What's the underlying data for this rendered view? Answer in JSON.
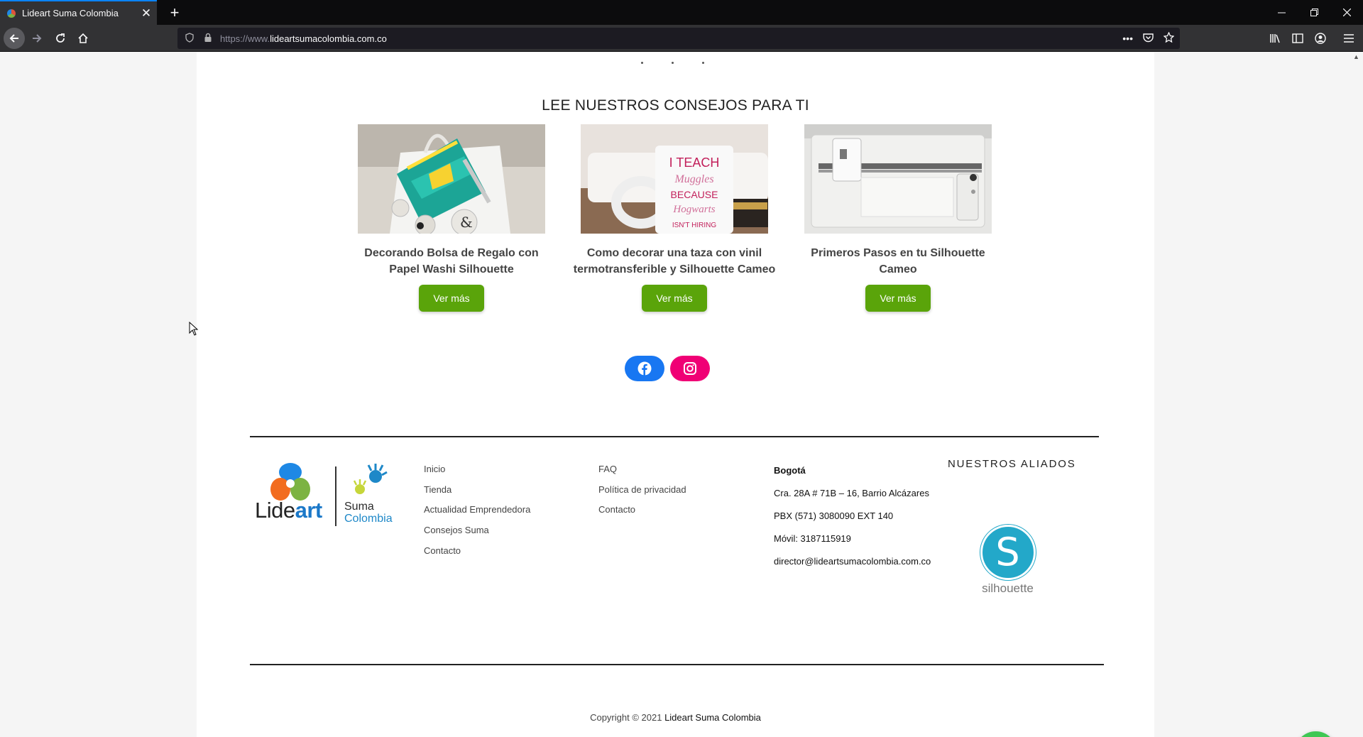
{
  "browser": {
    "tab_title": "Lideart Suma Colombia",
    "url_prefix": "https://www.",
    "url_domain": "lideartsumacolombia.com.co",
    "new_tab": "+",
    "tab_close": "✕"
  },
  "page": {
    "section_title": "LEE NUESTROS CONSEJOS PARA TI",
    "cards": [
      {
        "title": "Decorando Bolsa de Regalo con Papel Washi Silhouette",
        "button": "Ver más"
      },
      {
        "title": "Como decorar una taza con vinil termotransferible y Silhouette Cameo",
        "button": "Ver más",
        "mug_text": "I TEACH Muggles BECAUSE Hogwarts ISN'T HIRING"
      },
      {
        "title": "Primeros Pasos en tu Silhouette Cameo",
        "button": "Ver más"
      }
    ],
    "social": [
      "facebook",
      "instagram"
    ]
  },
  "footer": {
    "logo": {
      "lide": "Lide",
      "art": "art",
      "suma": "Suma",
      "colombia": "Colombia"
    },
    "links_col1": [
      "Inicio",
      "Tienda",
      "Actualidad Emprendedora",
      "Consejos Suma",
      "Contacto"
    ],
    "links_col2": [
      "FAQ",
      "Política de privacidad",
      "Contacto"
    ],
    "contact": {
      "city": "Bogotá",
      "address": "Cra. 28A # 71B – 16, Barrio Alcázares",
      "pbx": "PBX (571) 3080090 EXT 140",
      "mobile": "Móvil: 3187115919",
      "email": "director@lideartsumacolombia.com.co"
    },
    "partners_title": "NUESTROS ALIADOS",
    "partner_name": "silhouette",
    "partner_letter": "S",
    "copyright_prefix": "Copyright © 2021 ",
    "copyright_name": "Lideart Suma Colombia"
  },
  "colors": {
    "button": "#5aa40a",
    "facebook": "#1877f2",
    "instagram": "#f00075",
    "whatsapp": "#3fc754",
    "silhouette": "#23a8c9"
  }
}
